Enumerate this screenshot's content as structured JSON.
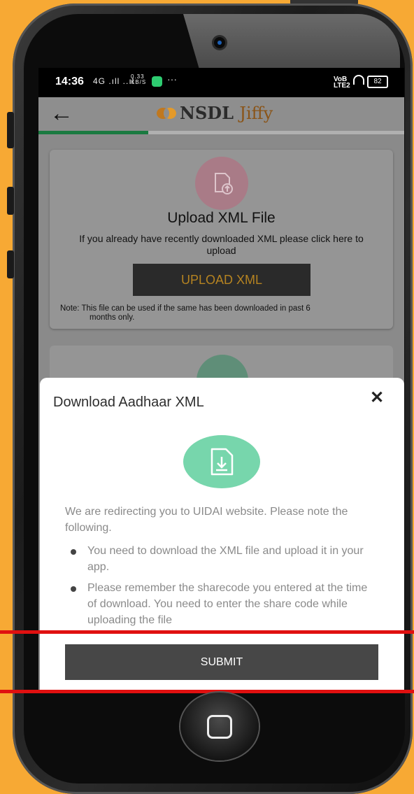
{
  "status_bar": {
    "time": "14:36",
    "signal": "4G .ıll ..ıl",
    "data_rate": "0.33 KB/S",
    "more": "···",
    "volte": "VoB LTE2",
    "battery": "82"
  },
  "app_bar": {
    "back_icon": "arrow-left-icon",
    "logo_nsdl": "NSDL",
    "logo_jiffy": "Jiffy",
    "progress_fraction": 0.3
  },
  "upload_card": {
    "icon": "upload-file-icon",
    "title": "Upload XML File",
    "description": "If you already have recently downloaded XML please click here to upload",
    "button_label": "UPLOAD XML",
    "note_line1": "Note:  This file can be used if the same has been downloaded in past 6",
    "note_line2": "months only."
  },
  "modal": {
    "title": "Download Aadhaar XML",
    "close_icon": "close-icon",
    "icon": "download-file-icon",
    "intro": "We are redirecting you to UIDAI website. Please note the following.",
    "bullets": [
      "You need to download the XML file and upload it in your app.",
      "Please remember the sharecode you entered at the time of download. You need to enter the share code while uploading the file"
    ],
    "submit_label": "SUBMIT"
  },
  "colors": {
    "background": "#F7A934",
    "accent_green": "#77D6AC",
    "upload_gold": "#B58321",
    "annotation_red": "#E01010"
  }
}
